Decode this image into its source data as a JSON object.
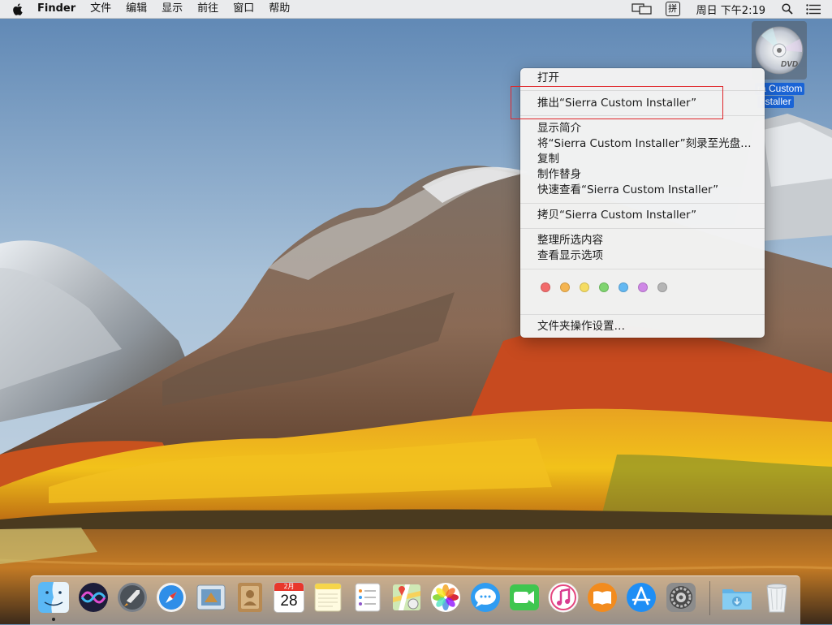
{
  "menubar": {
    "app_name": "Finder",
    "menus": [
      "文件",
      "编辑",
      "显示",
      "前往",
      "窗口",
      "帮助"
    ],
    "clock": "周日 下午2:19",
    "input_method": "拼"
  },
  "desktop_icon": {
    "label_line1": "ra Custom",
    "label_line2": "nstaller",
    "disc_text": "DVD"
  },
  "context_menu": {
    "items": [
      "打开",
      "推出“Sierra Custom Installer”",
      "显示简介",
      "将“Sierra Custom Installer”刻录至光盘…",
      "复制",
      "制作替身",
      "快速查看“Sierra Custom Installer”",
      "拷贝“Sierra Custom Installer”",
      "整理所选内容",
      "查看显示选项",
      "文件夹操作设置…"
    ],
    "tag_colors": [
      "#f26b6b",
      "#f5b551",
      "#f5dc62",
      "#7fd46f",
      "#63b8f2",
      "#cf88e6",
      "#b5b5b5"
    ],
    "highlighted_item": "推出“Sierra Custom Installer”"
  },
  "dock": {
    "apps": [
      "Finder",
      "Siri",
      "Launchpad",
      "Safari",
      "Mail",
      "Contacts",
      "Calendar",
      "Notes",
      "Reminders",
      "Maps",
      "Photos",
      "Messages",
      "FaceTime",
      "iTunes",
      "iBooks",
      "App Store",
      "System Preferences",
      "Downloads",
      "Trash"
    ],
    "calendar_month": "2月",
    "calendar_day": "28"
  },
  "colors": {
    "highlight_box": "#e0262a",
    "selection_blue": "#1a64d6"
  }
}
